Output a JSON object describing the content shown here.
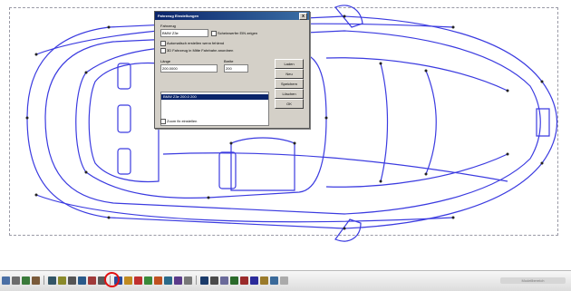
{
  "dialog": {
    "title": "Fahrzeug Einstellungen",
    "group_label": "Fahrzeug",
    "model_value": "BMW Z3e",
    "opt_lights": "Scheinwerfer EIN zeigen",
    "opt_auto": "Automatisch erstellen wenn fehlend",
    "opt_3d": "3D Fahrzeug in Mitte Fahrbahn anordnen",
    "label_length": "Länge",
    "length_value": "200.0000",
    "label_width": "Breite",
    "width_value": "200",
    "list_row": "BMW Z3e   200.0 200",
    "zoom_option": "Zoom fix einstellen",
    "buttons": [
      "Laden",
      "Neu",
      "Speichern",
      "Löschen",
      "OK"
    ],
    "close": "x"
  },
  "toolbar": {
    "highlighted_tool": "highlighted-tool-ring",
    "status": "Modellbereich"
  },
  "colors": {
    "drawing_line": "#3b3be0",
    "dialog_title": "#0a246a",
    "highlight": "#e01010"
  }
}
